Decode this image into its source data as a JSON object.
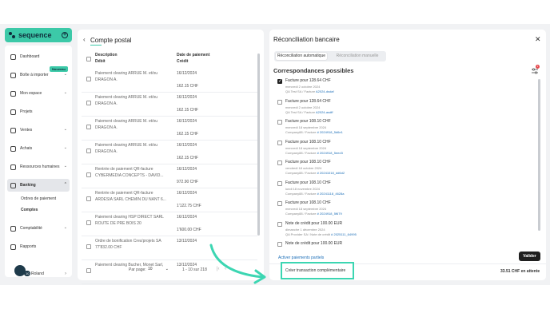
{
  "sidebar": {
    "logo": "sequence",
    "new_badge": "Nouveau",
    "items": [
      {
        "label": "Dashboard"
      },
      {
        "label": "Boîte à importer"
      },
      {
        "label": "Mon espace"
      },
      {
        "label": "Projets"
      },
      {
        "label": "Ventes"
      },
      {
        "label": "Achats"
      },
      {
        "label": "Ressources humaines"
      },
      {
        "label": "Banking"
      },
      {
        "label": "Comptabilité"
      },
      {
        "label": "Rapports"
      }
    ],
    "banking_sub": [
      "Ordres de paiement",
      "Comptes"
    ],
    "user": {
      "name": "Roland",
      "count": "10"
    }
  },
  "left_panel": {
    "title": "Compte postal",
    "headers": {
      "col1_a": "Description",
      "col1_b": "Débit",
      "col2_a": "Date de paiement",
      "col2_b": "Crédit"
    },
    "rows": [
      {
        "desc": "Paiement clearing ARRUE M. et/ou DRAGON A.",
        "date": "16/12/2024",
        "amount": "162.15 CHF"
      },
      {
        "desc": "Paiement clearing ARRUE M. et/ou DRAGON A.",
        "date": "16/12/2024",
        "amount": "162.15 CHF"
      },
      {
        "desc": "Paiement clearing ARRUE M. et/ou DRAGON A.",
        "date": "16/12/2024",
        "amount": "162.15 CHF"
      },
      {
        "desc": "Paiement clearing ARRUE M. et/ou DRAGON A.",
        "date": "16/12/2024",
        "amount": "162.15 CHF"
      },
      {
        "desc": "Rentrée de paiement QR-facture CYBERMEDIA CONCEPTS - DAVID...",
        "date": "16/12/2024",
        "amount": "972.90 CHF"
      },
      {
        "desc": "Rentrée de paiement QR-facture ARDESIA SARL CHEMIN DU NANT 6...",
        "date": "16/12/2024",
        "amount": "1'122.75 CHF"
      },
      {
        "desc": "Paiement clearing HSP DIRECT SARL ROUTE DE PRE BOIS 20",
        "date": "16/12/2024",
        "amount": "1'600.00 CHF"
      },
      {
        "desc": "Ordre de bonification Crea'projets SA 77'832.00 CHF",
        "date": "13/12/2024",
        "amount": ""
      },
      {
        "desc": "Paiement clearing Bucher, Monet Sarl,",
        "date": "13/12/2024",
        "amount": ""
      }
    ],
    "pager": {
      "label": "Par page:",
      "per_page": "10",
      "range": "1 - 10 sur 218"
    }
  },
  "right_panel": {
    "title": "Réconciliation bancaire",
    "tabs": {
      "auto": "Réconciliation automatique",
      "manual": "Réconciliation manuelle"
    },
    "section_title": "Correspondances possibles",
    "filter_count": "1",
    "matches": [
      {
        "title": "Facture pour 128.64 CHF",
        "date": "mercredi 2 octobre 2024",
        "ref_prefix": "QA Test SA / Facture ",
        "ref_link": "A2024-dsdaf",
        "checked": true
      },
      {
        "title": "Facture pour 128.64 CHF",
        "date": "mercredi 2 octobre 2024",
        "ref_prefix": "QA Test SA / Facture ",
        "ref_link": "A2024-asdff",
        "checked": false
      },
      {
        "title": "Facture pour 108.10 CHF",
        "date": "mercredi 18 septembre 2024",
        "ref_prefix": "Company88 / Facture ",
        "ref_link": "# 2024918_5d6e1",
        "checked": false
      },
      {
        "title": "Facture pour 108.10 CHF",
        "date": "mercredi 18 septembre 2024",
        "ref_prefix": "Company88 / Facture ",
        "ref_link": "# 2024918_5eed3",
        "checked": false
      },
      {
        "title": "Facture pour 108.10 CHF",
        "date": "vendredi 18 octobre 2024",
        "ref_prefix": "Company88 / Facture ",
        "ref_link": "# 20241018_dd6d2",
        "checked": false
      },
      {
        "title": "Facture pour 108.10 CHF",
        "date": "lundi 18 novembre 2024",
        "ref_prefix": "Company88 / Facture ",
        "ref_link": "# 20241118_4628a",
        "checked": false
      },
      {
        "title": "Facture pour 108.10 CHF",
        "date": "mercredi 18 septembre 2024",
        "ref_prefix": "Company88 / Facture ",
        "ref_link": "# 2024918_5f679",
        "checked": false
      },
      {
        "title": "Note de crédit pour 100.00 EUR",
        "date": "dimanche 1 décembre 2024",
        "ref_prefix": "QA Provider SA / Note de crédit ",
        "ref_link": "# 2025111_64995",
        "checked": false
      },
      {
        "title": "Note de crédit pour 100.00 EUR",
        "date": "",
        "ref_prefix": "",
        "ref_link": "",
        "checked": false
      }
    ],
    "activate_partial": "Activer paiements partiels",
    "validate": "Valider",
    "create_transaction": "Créer transaction complémentaire",
    "pending": "33.51 CHF en attente"
  }
}
